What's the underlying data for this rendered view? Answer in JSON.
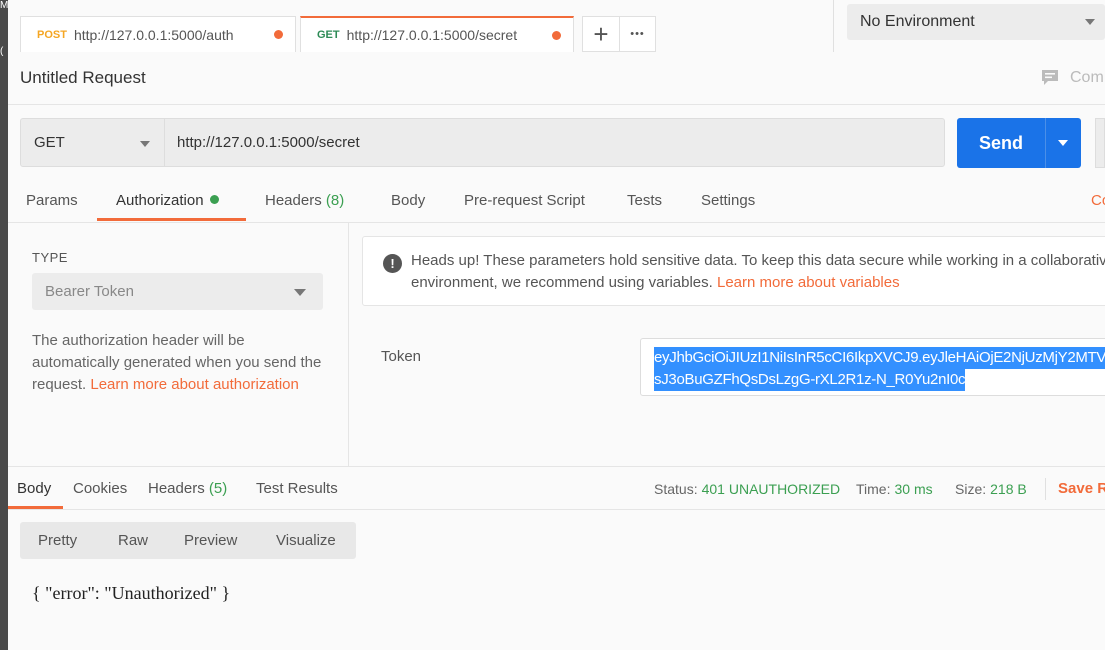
{
  "tabs": [
    {
      "method": "POST",
      "url": "http://127.0.0.1:5000/auth",
      "unsaved": true,
      "active": false
    },
    {
      "method": "GET",
      "url": "http://127.0.0.1:5000/secret",
      "unsaved": true,
      "active": true
    }
  ],
  "tab_actions": {
    "new_tab_icon": "plus-icon",
    "more_icon": "ellipsis-icon",
    "plus_glyph": "+",
    "more_glyph": "•••"
  },
  "environment": {
    "selected": "No Environment"
  },
  "request": {
    "title": "Untitled Request",
    "comments_label": "Com",
    "method": "GET",
    "url": "http://127.0.0.1:5000/secret",
    "send_label": "Send"
  },
  "request_tabs": {
    "params": "Params",
    "authorization": "Authorization",
    "headers": "Headers",
    "headers_count": "(8)",
    "body": "Body",
    "prerequest": "Pre-request Script",
    "tests": "Tests",
    "settings": "Settings",
    "cookies_edge": "Co"
  },
  "auth": {
    "type_label": "TYPE",
    "type_selected": "Bearer Token",
    "description": "The authorization header will be automatically generated when you send the request. ",
    "description_link": "Learn more about authorization",
    "headsup_icon": "!",
    "headsup_text": "Heads up! These parameters hold sensitive data. To keep this data secure while working in a collaborative environment, we recommend using variables. ",
    "headsup_link": "Learn more about variables",
    "token_label": "Token",
    "token_line1": "eyJhbGciOiJIUzI1NiIsInR5cCI6IkpXVCJ9.eyJleHAiOjE2NjUzMjY2MTV",
    "token_line2": "sJ3oBuGZFhQsDsLzgG-rXL2R1z-N_R0Yu2nI0c"
  },
  "response_tabs": {
    "body": "Body",
    "cookies": "Cookies",
    "headers": "Headers",
    "headers_count": "(5)",
    "test_results": "Test Results"
  },
  "response_status": {
    "status_label": "Status:",
    "status_value": "401 UNAUTHORIZED",
    "time_label": "Time:",
    "time_value": "30 ms",
    "size_label": "Size:",
    "size_value": "218 B",
    "save_label": "Save R"
  },
  "view_tabs": {
    "pretty": "Pretty",
    "raw": "Raw",
    "preview": "Preview",
    "visualize": "Visualize"
  },
  "response_body": "{ \"error\": \"Unauthorized\" }",
  "colors": {
    "accent": "#f26b3a",
    "send": "#1a73e8",
    "success": "#3b9f51",
    "selection": "#3390ff"
  }
}
